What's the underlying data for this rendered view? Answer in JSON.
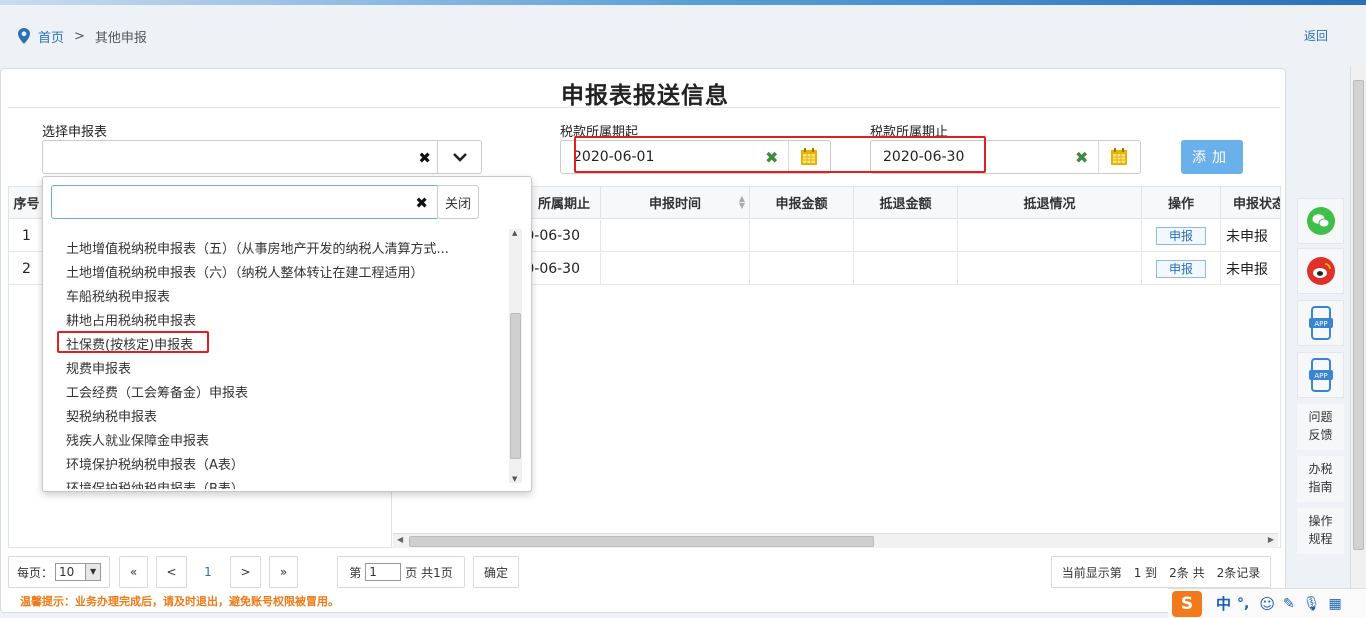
{
  "breadcrumb": {
    "home": "首页",
    "sep": ">",
    "current": "其他申报"
  },
  "back_label": "返回",
  "page_title": "申报表报送信息",
  "form": {
    "select_label": "选择申报表",
    "tax_start_label": "税款所属期起",
    "tax_start_value": "2020-06-01",
    "tax_end_label": "税款所属期止",
    "tax_end_value": "2020-06-30",
    "add_label": "添加"
  },
  "dropdown": {
    "close_label": "关闭",
    "items": [
      "土地增值税纳税申报表（五）（从事房地产开发的纳税人清算方式...",
      "土地增值税纳税申报表（六）（纳税人整体转让在建工程适用）",
      "车船税纳税申报表",
      "耕地占用税纳税申报表",
      "社保费(按核定)申报表",
      "规费申报表",
      "工会经费（工会筹备金）申报表",
      "契税纳税申报表",
      "残疾人就业保障金申报表",
      "环境保护税纳税申报表（A表）",
      "环境保护税纳税申报表（B表）"
    ]
  },
  "table": {
    "seq_header": "序号",
    "headers": [
      "所属期止",
      "申报时间",
      "申报金额",
      "抵退金额",
      "抵退情况",
      "操作",
      "申报状态"
    ],
    "rows": [
      {
        "seq": "1",
        "end": "0-06-30",
        "time": "",
        "amount": "",
        "refund": "",
        "refund_status": "",
        "op": "申报",
        "status": "未申报"
      },
      {
        "seq": "2",
        "end": "0-06-30",
        "time": "",
        "amount": "",
        "refund": "",
        "refund_status": "",
        "op": "申报",
        "status": "未申报"
      }
    ]
  },
  "pager": {
    "per_page_label": "每页：",
    "per_page_value": "10",
    "first": "«",
    "prev": "<",
    "current": "1",
    "next": ">",
    "last": "»",
    "page_prefix": "第",
    "page_value": "1",
    "page_suffix": "页 共1页",
    "confirm": "确定",
    "summary": "当前显示第　1 到　2条 共　2条记录"
  },
  "tip": "温馨提示：业务办理完成后，请及时退出，避免账号权限被冒用。",
  "side": {
    "app1": "APP",
    "app2": "APP",
    "feedback": "问题\n反馈",
    "guide": "办税\n指南",
    "rules": "操作\n规程"
  },
  "ime": {
    "mode": "中"
  },
  "colors": {
    "accent": "#2a6fba",
    "add_button": "#6ab0ea",
    "highlight": "#e02020",
    "tip": "#f07a17"
  }
}
